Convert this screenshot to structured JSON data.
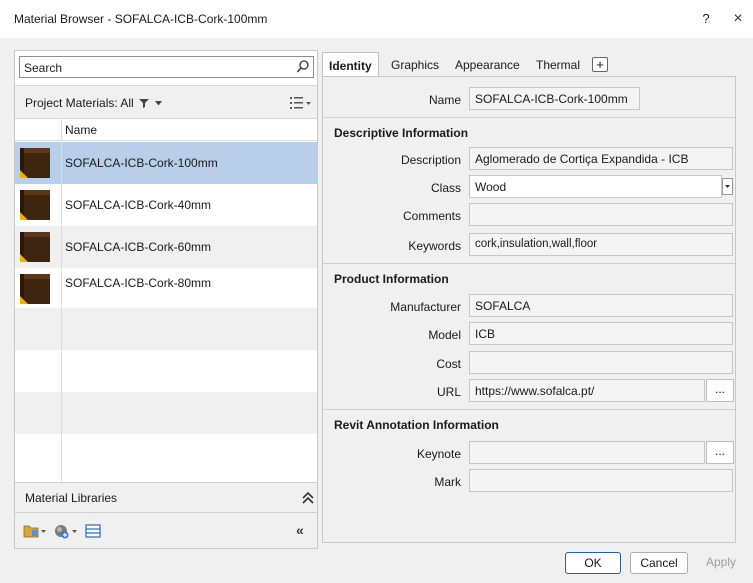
{
  "window": {
    "title": "Material Browser - SOFALCA-ICB-Cork-100mm",
    "help": "?",
    "close": "×"
  },
  "left": {
    "search_placeholder": "Search",
    "project_filter": "Project Materials: All",
    "table": {
      "column_name": "Name",
      "rows": [
        {
          "name": "SOFALCA-ICB-Cork-100mm",
          "selected": true
        },
        {
          "name": "SOFALCA-ICB-Cork-40mm",
          "selected": false
        },
        {
          "name": "SOFALCA-ICB-Cork-60mm",
          "selected": false
        },
        {
          "name": "SOFALCA-ICB-Cork-80mm",
          "selected": false
        }
      ]
    },
    "libraries_label": "Material Libraries",
    "collapse_label": "«"
  },
  "tabs": [
    {
      "label": "Identity",
      "active": true
    },
    {
      "label": "Graphics",
      "active": false
    },
    {
      "label": "Appearance",
      "active": false
    },
    {
      "label": "Thermal",
      "active": false
    },
    {
      "label": "+",
      "active": false
    }
  ],
  "identity": {
    "name_label": "Name",
    "name_value": "SOFALCA-ICB-Cork-100mm",
    "descriptive": {
      "heading": "Descriptive Information",
      "description_label": "Description",
      "description_value": "Aglomerado de Cortiça Expandida - ICB",
      "class_label": "Class",
      "class_value": "Wood",
      "comments_label": "Comments",
      "comments_value": "",
      "keywords_label": "Keywords",
      "keywords_value": "cork,insulation,wall,floor"
    },
    "product": {
      "heading": "Product Information",
      "manufacturer_label": "Manufacturer",
      "manufacturer_value": "SOFALCA",
      "model_label": "Model",
      "model_value": "ICB",
      "cost_label": "Cost",
      "cost_value": "",
      "url_label": "URL",
      "url_value": "https://www.sofalca.pt/",
      "url_browse": "..."
    },
    "annotation": {
      "heading": "Revit Annotation Information",
      "keynote_label": "Keynote",
      "keynote_value": "",
      "keynote_browse": "...",
      "mark_label": "Mark",
      "mark_value": ""
    }
  },
  "footer": {
    "ok": "OK",
    "cancel": "Cancel",
    "apply": "Apply"
  },
  "colors": {
    "selected_row": "#b9cfe9",
    "primary_border": "#2a5fa8"
  }
}
